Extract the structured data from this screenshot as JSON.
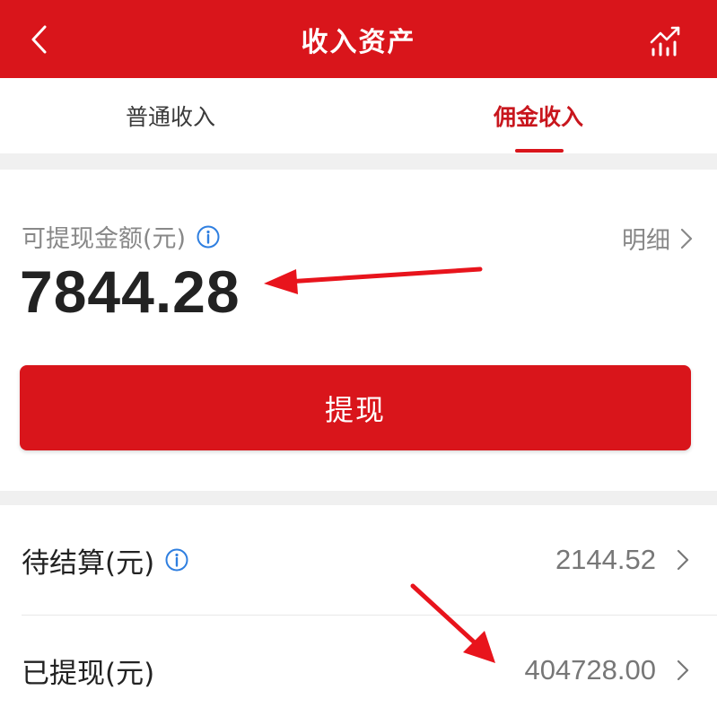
{
  "header": {
    "title": "收入资产",
    "back_icon": "chevron-left-icon",
    "chart_icon": "bar-chart-trend-icon"
  },
  "tabs": [
    {
      "label": "普通收入",
      "active": false
    },
    {
      "label": "佣金收入",
      "active": true
    }
  ],
  "withdraw": {
    "label": "可提现金额(元)",
    "info_icon": "info-icon",
    "detail_label": "明细",
    "amount": "7844.28",
    "button_label": "提现"
  },
  "list": [
    {
      "label": "待结算(元)",
      "has_info": true,
      "value": "2144.52"
    },
    {
      "label": "已提现(元)",
      "has_info": false,
      "value": "404728.00"
    }
  ],
  "colors": {
    "brand_red": "#d9151b",
    "active_tab": "#c8161d",
    "info_blue": "#2f7fe0",
    "annotation_red": "#e8141c"
  }
}
